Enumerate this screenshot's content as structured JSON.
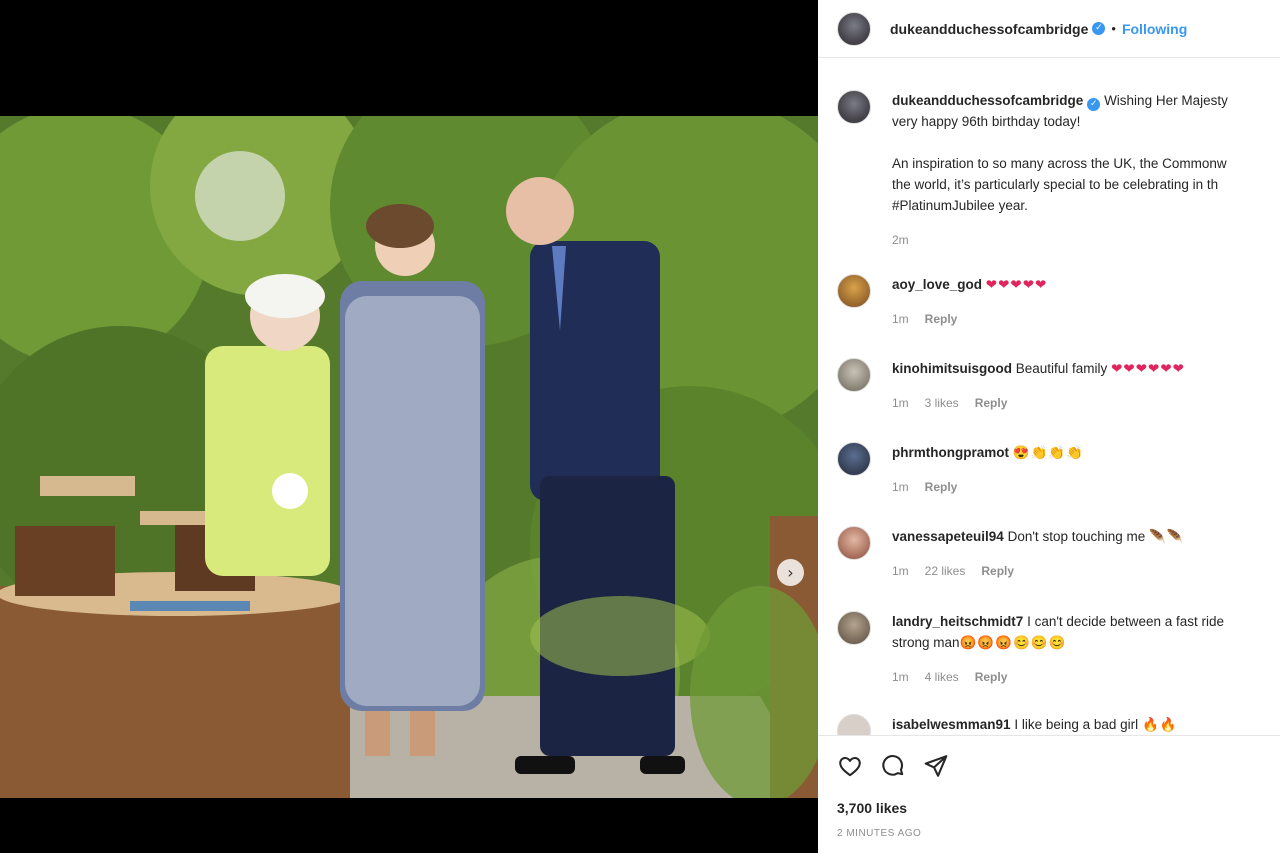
{
  "post": {
    "username": "dukeandduchessofcambridge",
    "follow_status": "Following",
    "separator": "•",
    "verified_glyph": "✓"
  },
  "caption": {
    "username": "dukeandduchessofcambridge",
    "lines": [
      "Wishing Her Majesty",
      "very happy 96th birthday today!",
      "",
      "An inspiration to so many across the UK, the Commonw",
      "the world, it’s particularly special to be celebrating in th",
      "#PlatinumJubilee year."
    ],
    "time": "2m"
  },
  "comments": [
    {
      "username": "aoy_love_god",
      "text": "",
      "emoji": "❤❤❤❤❤",
      "emoji_kind": "hearts",
      "time": "1m",
      "likes": "",
      "reply": "Reply"
    },
    {
      "username": "kinohimitsuisgood",
      "text": "Beautiful family",
      "emoji": "❤❤❤❤❤❤",
      "emoji_kind": "hearts",
      "time": "1m",
      "likes": "3 likes",
      "reply": "Reply"
    },
    {
      "username": "phrmthongpramot",
      "text": "",
      "emoji": "😍👏👏👏",
      "emoji_kind": "emo",
      "time": "1m",
      "likes": "",
      "reply": "Reply"
    },
    {
      "username": "vanessapeteuil94",
      "text": "Don't stop touching me",
      "emoji": "🪶🪶",
      "emoji_kind": "emo",
      "time": "1m",
      "likes": "22 likes",
      "reply": "Reply"
    },
    {
      "username": "landry_heitschmidt7",
      "text": "I can't decide between a fast ride",
      "line2": "strong man",
      "emoji": "😡😡😡😊😊😊",
      "emoji_kind": "emo",
      "time": "1m",
      "likes": "4 likes",
      "reply": "Reply"
    },
    {
      "username": "isabelwesmman91",
      "text": "I like being a bad girl",
      "emoji": "🔥🔥",
      "emoji_kind": "emo"
    }
  ],
  "actions": {
    "likes": "3,700 likes",
    "timestamp": "2 MINUTES AGO",
    "icons": [
      "heart-icon",
      "comment-icon",
      "share-icon"
    ]
  },
  "carousel": {
    "next_glyph": "›",
    "slide_count": 2,
    "current_slide": 1
  },
  "colors": {
    "link": "#3897f0",
    "text": "#262626",
    "muted": "#8e8e8e",
    "heart": "#e0245e"
  }
}
